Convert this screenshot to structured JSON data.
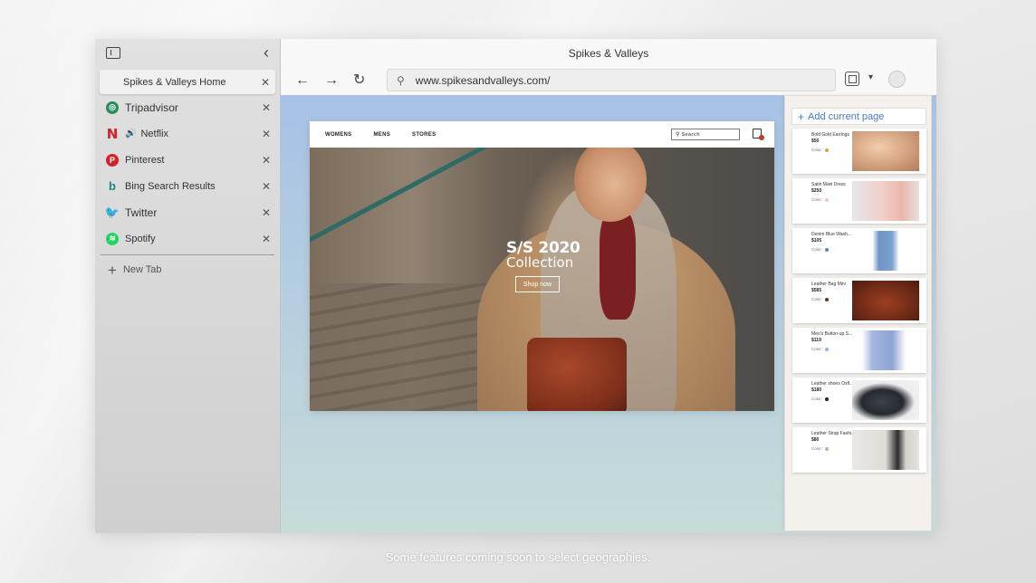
{
  "window": {
    "title": "Spikes & Valleys"
  },
  "sidebar": {
    "tabs": [
      {
        "label": "Spikes & Valleys Home",
        "icon": "none",
        "active": true
      },
      {
        "label": "Tripadvisor",
        "icon": "tripadvisor-icon"
      },
      {
        "label": "Netflix",
        "icon": "netflix-icon",
        "audio": true
      },
      {
        "label": "Pinterest",
        "icon": "pinterest-icon"
      },
      {
        "label": "Bing Search Results",
        "icon": "bing-icon"
      },
      {
        "label": "Twitter",
        "icon": "twitter-icon"
      },
      {
        "label": "Spotify",
        "icon": "spotify-icon"
      }
    ],
    "new_tab_label": "New Tab"
  },
  "toolbar": {
    "url": "www.spikesandvalleys.com/"
  },
  "site": {
    "nav": [
      "WOMENS",
      "MENS",
      "STORES"
    ],
    "search_placeholder": "Search",
    "hero_title": "S/S 2020",
    "hero_subtitle": "Collection",
    "shop_button": "Shop now"
  },
  "collections": {
    "add_label": "Add current page",
    "items": [
      {
        "name": "Bold Gold Earrings",
        "price": "$50",
        "color_label": "Color:",
        "color": "#d4a640"
      },
      {
        "name": "Satin Maxi Dress",
        "price": "$250",
        "color_label": "Color:",
        "color": "#f2c7c0"
      },
      {
        "name": "Denim Blue Wash...",
        "price": "$105",
        "color_label": "Color:",
        "color": "#5b86c2"
      },
      {
        "name": "Leather Bag Mini",
        "price": "$585",
        "color_label": "Color:",
        "color": "#7a2a16"
      },
      {
        "name": "Men's Button-up S...",
        "price": "$119",
        "color_label": "Color:",
        "color": "#9bb0d8"
      },
      {
        "name": "Leather shoes Oxfl...",
        "price": "$180",
        "color_label": "Color:",
        "color": "#222222"
      },
      {
        "name": "Leather Strap Fashi...",
        "price": "$80",
        "color_label": "Color:",
        "color": "#c9b08a"
      }
    ]
  },
  "footer": {
    "caption": "Some features coming soon to select geographies."
  }
}
